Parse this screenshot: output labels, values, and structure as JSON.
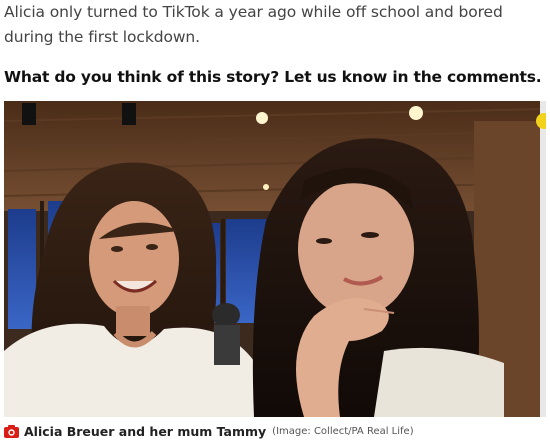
{
  "article": {
    "paragraph": "Alicia only turned to TikTok a year ago while off school and bored during the first lockdown.",
    "cta": "What do you think of this story? Let us know in the comments."
  },
  "photo": {
    "caption": "Alicia Breuer and her mum Tammy",
    "credit": "(Image: Collect/PA Real Life)",
    "caption_icon": "camera-icon",
    "accent_color": "#d91e18"
  }
}
